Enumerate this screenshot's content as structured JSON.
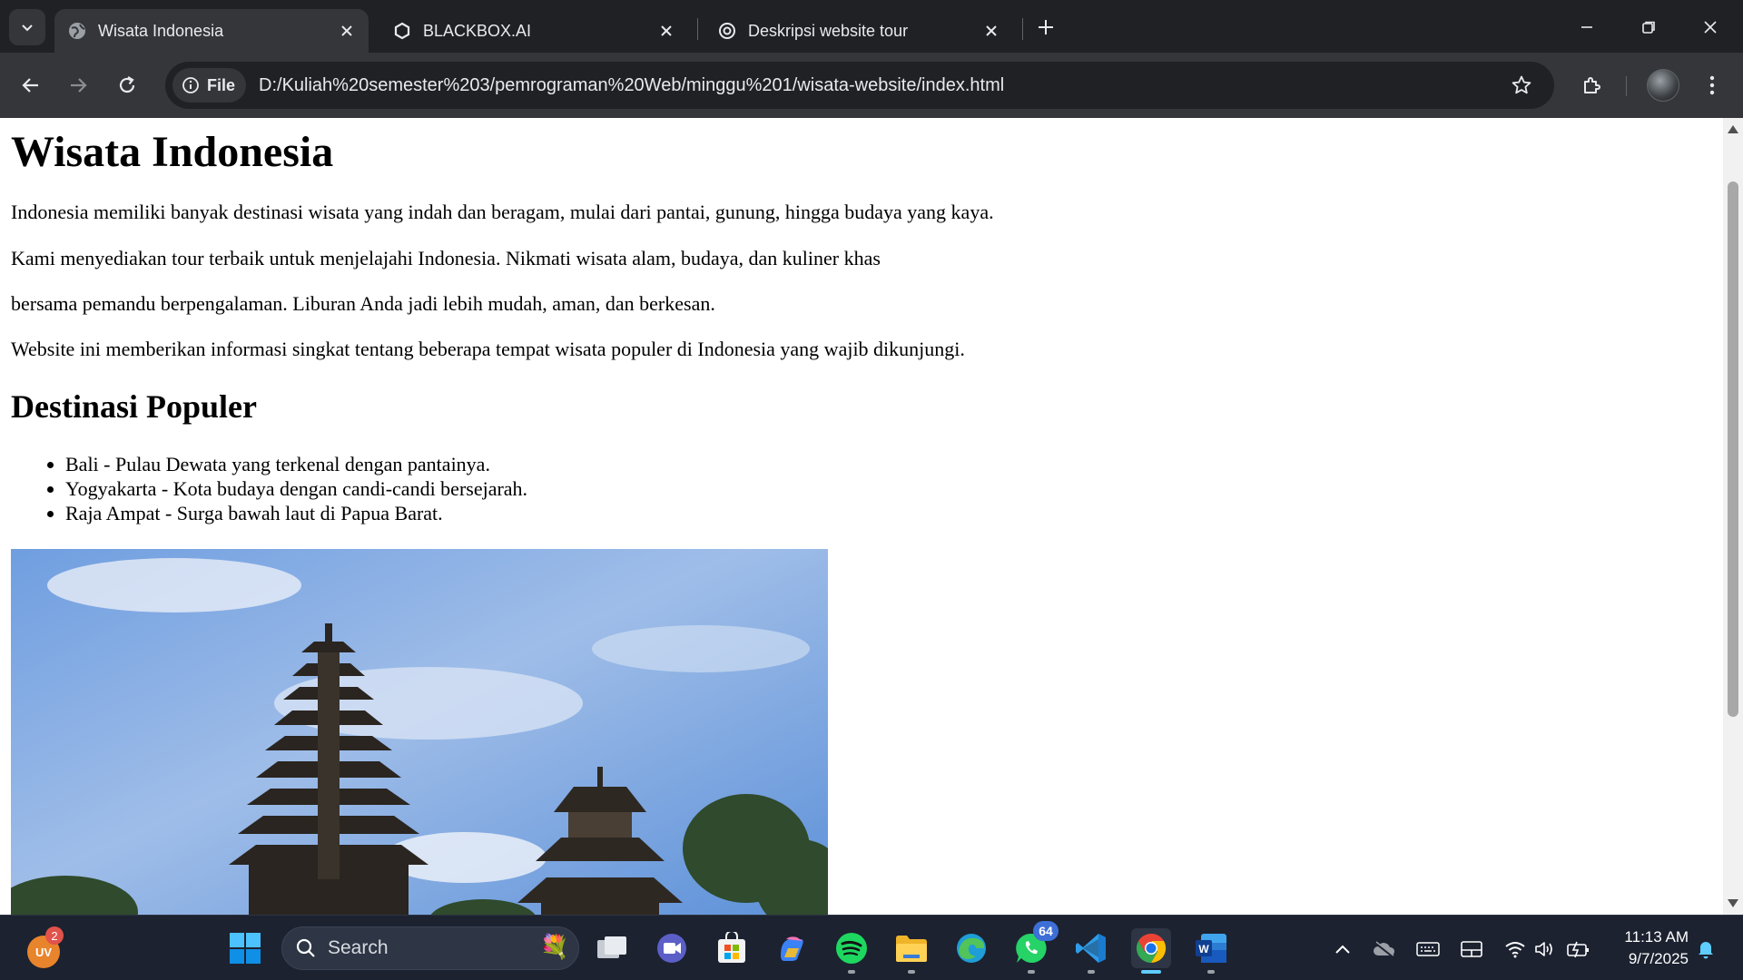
{
  "browser": {
    "tabs": [
      {
        "title": "Wisata Indonesia",
        "favicon": "globe-icon",
        "active": true
      },
      {
        "title": "BLACKBOX.AI",
        "favicon": "blackbox-icon",
        "active": false
      },
      {
        "title": "Deskripsi website tour",
        "favicon": "chatgpt-icon",
        "active": false
      }
    ],
    "address": {
      "chip_label": "File",
      "url": "D:/Kuliah%20semester%203/pemrograman%20Web/minggu%201/wisata-website/index.html"
    }
  },
  "page": {
    "heading": "Wisata Indonesia",
    "paragraphs": [
      "Indonesia memiliki banyak destinasi wisata yang indah dan beragam, mulai dari pantai, gunung, hingga budaya yang kaya.",
      "Kami menyediakan tour terbaik untuk menjelajahi Indonesia. Nikmati wisata alam, budaya, dan kuliner khas",
      "bersama pemandu berpengalaman. Liburan Anda jadi lebih mudah, aman, dan berkesan.",
      "Website ini memberikan informasi singkat tentang beberapa tempat wisata populer di Indonesia yang wajib dikunjungi."
    ],
    "subheading": "Destinasi Populer",
    "destinations": [
      "Bali - Pulau Dewata yang terkenal dengan pantainya.",
      "Yogyakarta - Kota budaya dengan candi-candi bersejarah.",
      "Raja Ampat - Surga bawah laut di Papua Barat."
    ]
  },
  "taskbar": {
    "user_initials": "UV",
    "user_badge": "2",
    "search_placeholder": "Search",
    "whatsapp_badge": "64",
    "time": "11:13 AM",
    "date": "9/7/2025"
  },
  "colors": {
    "tab_strip": "#202124",
    "toolbar": "#35363a",
    "taskbar": "#1c2230",
    "accent": "#60cdff"
  }
}
